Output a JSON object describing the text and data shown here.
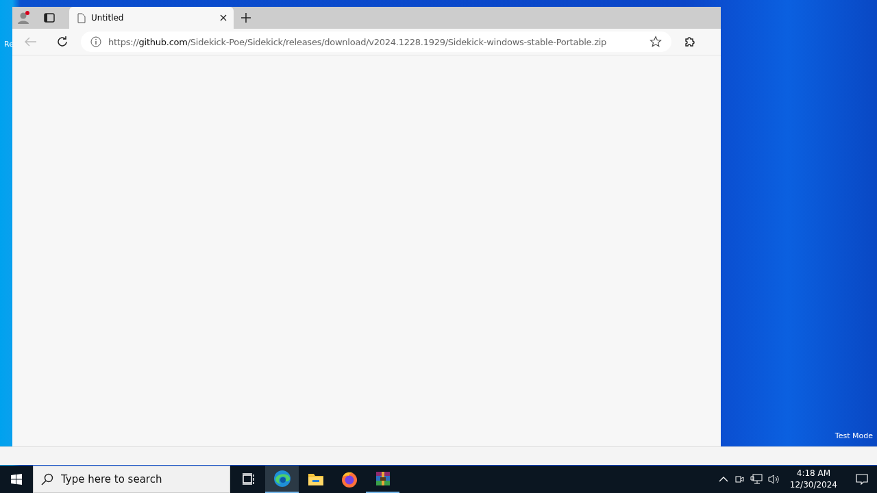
{
  "desktop": {
    "icon_labels": [
      "Re"
    ],
    "test_mode": "Test Mode"
  },
  "browser": {
    "tabs": [
      {
        "title": "Untitled",
        "selected": true
      }
    ],
    "address_bar": {
      "url": "https://**github.com**/Sidekick-Poe/Sidekick/releases/download/v2024.1228.1929/Sidekick-windows-stable-Portable.zip"
    },
    "back_disabled": true
  },
  "taskbar": {
    "search": {
      "placeholder": "Type here to search"
    },
    "apps": [
      {
        "kind": "taskview",
        "selected": false,
        "running": false
      },
      {
        "kind": "edge",
        "selected": true,
        "running": true
      },
      {
        "kind": "explorer",
        "selected": false,
        "running": false
      },
      {
        "kind": "firefox",
        "selected": false,
        "running": false
      },
      {
        "kind": "winrar",
        "selected": false,
        "running": true
      }
    ],
    "clock": {
      "time": "4:18 AM",
      "date": "12/30/2024"
    }
  }
}
